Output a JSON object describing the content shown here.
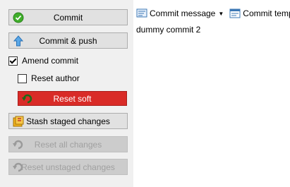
{
  "commit_panel": {
    "commit_label": "Commit",
    "commit_push_label": "Commit & push",
    "amend_label": "Amend commit",
    "amend_checked": true,
    "reset_author_label": "Reset author",
    "reset_author_checked": false,
    "reset_soft_label": "Reset soft",
    "stash_label": "Stash staged changes",
    "reset_all_label": "Reset all changes",
    "reset_unstaged_label": "Reset unstaged changes"
  },
  "message_panel": {
    "commit_message_label": "Commit message",
    "commit_template_label": "Commit temp",
    "message_text": "dummy commit 2"
  },
  "colors": {
    "danger": "#d92b27",
    "panel_bg": "#f0f0f0"
  },
  "icons": {
    "commit": "green-check-circle-icon",
    "commit_push": "blue-up-arrow-icon",
    "reset_soft": "undo-arrow-icon",
    "stash": "stash-icon",
    "reset_all": "undo-arrow-icon",
    "reset_unstaged": "undo-arrow-icon",
    "commit_message": "message-icon",
    "commit_template": "template-icon"
  }
}
